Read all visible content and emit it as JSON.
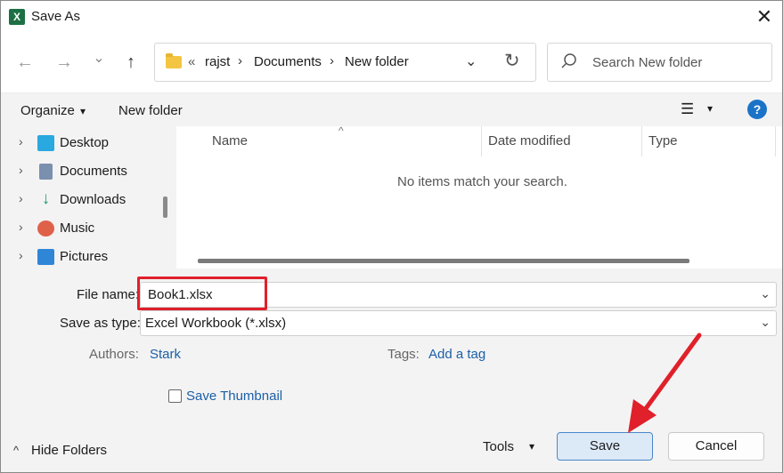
{
  "window": {
    "title": "Save As",
    "app_icon_letter": "X",
    "close_glyph": "✕"
  },
  "nav": {
    "back_glyph": "←",
    "forward_glyph": "→",
    "recent_glyph": "⌄",
    "up_glyph": "↑"
  },
  "address": {
    "overflow": "«",
    "crumbs": [
      "rajst",
      "Documents",
      "New folder"
    ],
    "separator": "›",
    "chevron": "⌄",
    "refresh_glyph": "↻"
  },
  "search": {
    "placeholder": "Search New folder"
  },
  "toolbar": {
    "organize_label": "Organize",
    "organize_caret": "▾",
    "new_folder_label": "New folder",
    "view_glyph": "☰",
    "view_caret": "▾",
    "help_glyph": "?"
  },
  "sidebar": {
    "items": [
      {
        "label": "Desktop",
        "icon": "desktop-icon",
        "color": "#2aa8e0"
      },
      {
        "label": "Documents",
        "icon": "documents-icon",
        "color": "#7b8fae"
      },
      {
        "label": "Downloads",
        "icon": "downloads-icon",
        "color": "#1e9e6a"
      },
      {
        "label": "Music",
        "icon": "music-icon",
        "color": "#e0614a"
      },
      {
        "label": "Pictures",
        "icon": "pictures-icon",
        "color": "#2f86d6"
      }
    ],
    "chevron": "›"
  },
  "filelist": {
    "columns": [
      "Name",
      "Date modified",
      "Type"
    ],
    "sort_caret": "^",
    "empty_message": "No items match your search."
  },
  "form": {
    "file_name_label": "File name:",
    "file_name_value": "Book1.xlsx",
    "save_type_label": "Save as type:",
    "save_type_value": "Excel Workbook (*.xlsx)",
    "authors_label": "Authors:",
    "authors_value": "Stark",
    "tags_label": "Tags:",
    "tags_value": "Add a tag",
    "thumbnail_label": "Save Thumbnail",
    "dropdown_chevron": "⌄"
  },
  "footer": {
    "hide_folders_label": "Hide Folders",
    "hide_folders_glyph": "^",
    "tools_label": "Tools",
    "tools_caret": "▾",
    "save_label": "Save",
    "cancel_label": "Cancel"
  },
  "annotation": {
    "highlight_color": "#e0202a"
  }
}
